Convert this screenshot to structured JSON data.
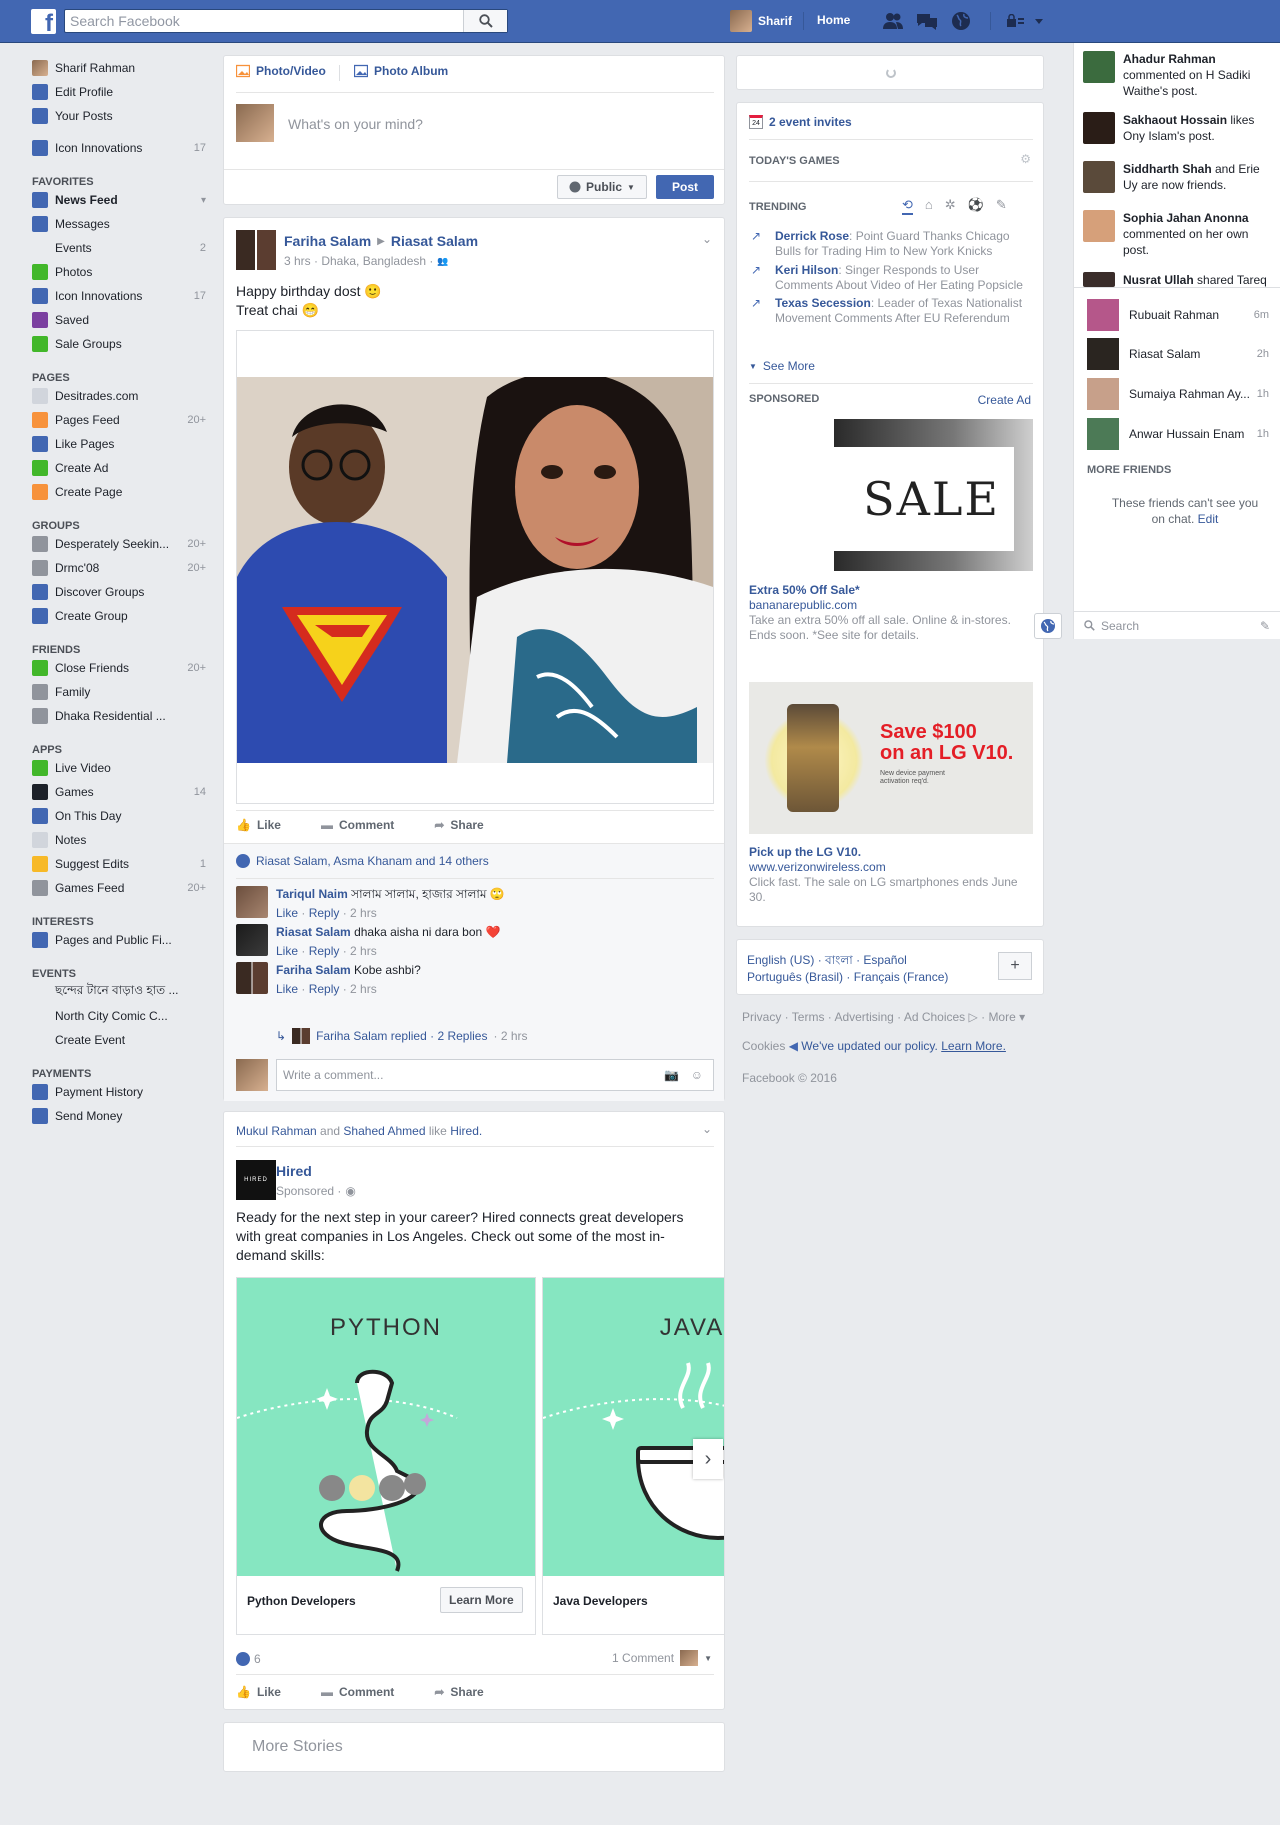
{
  "topbar": {
    "search_placeholder": "Search Facebook",
    "user_name": "Sharif",
    "home_label": "Home"
  },
  "leftnav": {
    "profile": [
      {
        "label": "Sharif Rahman",
        "icon": "avatar"
      },
      {
        "label": "Edit Profile",
        "icon": "pencil-icon"
      },
      {
        "label": "Your Posts",
        "icon": "person-icon"
      }
    ],
    "page_shortcut": {
      "label": "Icon Innovations",
      "count": "17"
    },
    "sections": [
      {
        "title": "FAVORITES",
        "items": [
          {
            "label": "News Feed",
            "count": "",
            "bold": true,
            "icon": "news-feed-icon",
            "color": "#4267b2"
          },
          {
            "label": "Messages",
            "count": "",
            "icon": "messages-icon",
            "color": "#4267b2"
          },
          {
            "label": "Events",
            "count": "2",
            "icon": "calendar-icon",
            "color": "#e9ebee"
          },
          {
            "label": "Photos",
            "count": "",
            "icon": "photos-icon",
            "color": "#42b72a"
          },
          {
            "label": "Icon Innovations",
            "count": "17",
            "icon": "page-icon",
            "color": "#4267b2"
          },
          {
            "label": "Saved",
            "count": "",
            "icon": "bookmark-icon",
            "color": "#7b3fa0"
          },
          {
            "label": "Sale Groups",
            "count": "",
            "icon": "tag-icon",
            "color": "#42b72a"
          }
        ]
      },
      {
        "title": "PAGES",
        "items": [
          {
            "label": "Desitrades.com",
            "count": "",
            "icon": "page-icon",
            "color": "#d1d5dc"
          },
          {
            "label": "Pages Feed",
            "count": "20+",
            "icon": "flag-icon",
            "color": "#f7923b"
          },
          {
            "label": "Like Pages",
            "count": "",
            "icon": "like-icon",
            "color": "#4267b2"
          },
          {
            "label": "Create Ad",
            "count": "",
            "icon": "plus-icon",
            "color": "#42b72a"
          },
          {
            "label": "Create Page",
            "count": "",
            "icon": "flag-plus-icon",
            "color": "#f7923b"
          }
        ]
      },
      {
        "title": "GROUPS",
        "items": [
          {
            "label": "Desperately Seekin...",
            "count": "20+",
            "icon": "group-icon",
            "color": "#90949c"
          },
          {
            "label": "Drmc'08",
            "count": "20+",
            "icon": "group-icon",
            "color": "#90949c"
          },
          {
            "label": "Discover Groups",
            "count": "",
            "icon": "discover-icon",
            "color": "#4267b2"
          },
          {
            "label": "Create Group",
            "count": "",
            "icon": "plus-icon",
            "color": "#4267b2"
          }
        ]
      },
      {
        "title": "FRIENDS",
        "items": [
          {
            "label": "Close Friends",
            "count": "20+",
            "icon": "star-icon",
            "color": "#42b72a"
          },
          {
            "label": "Family",
            "count": "",
            "icon": "family-icon",
            "color": "#90949c"
          },
          {
            "label": "Dhaka Residential ...",
            "count": "",
            "icon": "school-icon",
            "color": "#90949c"
          }
        ]
      },
      {
        "title": "APPS",
        "items": [
          {
            "label": "Live Video",
            "count": "",
            "icon": "live-icon",
            "color": "#42b72a"
          },
          {
            "label": "Games",
            "count": "14",
            "icon": "games-icon",
            "color": "#1d2129"
          },
          {
            "label": "On This Day",
            "count": "",
            "icon": "clock-icon",
            "color": "#4267b2"
          },
          {
            "label": "Notes",
            "count": "",
            "icon": "notes-icon",
            "color": "#d1d5dc"
          },
          {
            "label": "Suggest Edits",
            "count": "1",
            "icon": "edit-icon",
            "color": "#f7b928"
          },
          {
            "label": "Games Feed",
            "count": "20+",
            "icon": "games-feed-icon",
            "color": "#90949c"
          }
        ]
      },
      {
        "title": "INTERESTS",
        "items": [
          {
            "label": "Pages and Public Fi...",
            "count": "",
            "icon": "rss-icon",
            "color": "#4267b2"
          }
        ]
      },
      {
        "title": "EVENTS",
        "items": [
          {
            "label": "ছন্দের টানে বাড়াও হাত ...",
            "count": "",
            "icon": "calendar-icon",
            "color": "#e9ebee"
          },
          {
            "label": "North City Comic C...",
            "count": "",
            "icon": "calendar-icon",
            "color": "#e9ebee"
          },
          {
            "label": "Create Event",
            "count": "",
            "icon": "calendar-plus-icon",
            "color": "#e9ebee"
          }
        ]
      },
      {
        "title": "PAYMENTS",
        "items": [
          {
            "label": "Payment History",
            "count": "",
            "icon": "payment-icon",
            "color": "#4267b2"
          },
          {
            "label": "Send Money",
            "count": "",
            "icon": "money-icon",
            "color": "#4267b2"
          }
        ]
      }
    ]
  },
  "composer": {
    "photo_video": "Photo/Video",
    "photo_album": "Photo Album",
    "placeholder": "What's on your mind?",
    "privacy": "Public",
    "post_button": "Post"
  },
  "post1": {
    "author": "Fariha Salam",
    "target": "Riasat Salam",
    "meta": "3 hrs · Dhaka, Bangladesh ·",
    "text_line1": "Happy birthday dost 🙂",
    "text_line2": "Treat chai 😁",
    "like": "Like",
    "comment": "Comment",
    "share": "Share",
    "likes_summary": "Riasat Salam, Asma Khanam and 14 others",
    "comments": [
      {
        "author": "Tariqul Naim",
        "text": "সালাম সালাম, হাজার সালাম 🙄",
        "time": "2 hrs"
      },
      {
        "author": "Riasat Salam",
        "text": "dhaka aisha ni dara bon ❤️",
        "time": "2 hrs"
      },
      {
        "author": "Fariha Salam",
        "text": "Kobe ashbi?",
        "time": "2 hrs"
      }
    ],
    "reply_label": "Like",
    "reply_word": "Reply",
    "replied_text": "Fariha Salam replied · 2 Replies",
    "replied_time": "· 2 hrs",
    "write_comment": "Write a comment..."
  },
  "post2": {
    "liked_by": "Mukul Rahman and Shahed Ahmed like Hired.",
    "liker1": "Mukul Rahman",
    "liker2": "Shahed Ahmed",
    "and_word": "and",
    "like_word": "like",
    "page_name": "Hired.",
    "author": "Hired",
    "sponsored": "Sponsored ·",
    "logo_text": "HIRED",
    "text": "Ready for the next step in your career? Hired connects great developers with great companies in Los Angeles. Check out some of the most in-demand skills:",
    "cards": [
      {
        "heading": "PYTHON",
        "title": "Python Developers",
        "cta": "Learn More"
      },
      {
        "heading": "JAVA",
        "title": "Java Developers",
        "cta": ""
      }
    ],
    "reactions_count": "6",
    "comments_count": "1 Comment",
    "like": "Like",
    "comment": "Comment",
    "share": "Share"
  },
  "more_stories": "More Stories",
  "rightcol": {
    "event_invites": "2 event invites",
    "todays_games": "TODAY'S GAMES",
    "trending": "TRENDING",
    "trends": [
      {
        "name": "Derrick Rose",
        "text": ": Point Guard Thanks Chicago Bulls for Trading Him to New York Knicks"
      },
      {
        "name": "Keri Hilson",
        "text": ": Singer Responds to User Comments About Video of Her Eating Popsicle"
      },
      {
        "name": "Texas Secession",
        "text": ": Leader of Texas Nationalist Movement Comments After EU Referendum"
      }
    ],
    "see_more": "See More",
    "sponsored": "SPONSORED",
    "create_ad": "Create Ad",
    "ad1": {
      "image_text": "SALE",
      "title": "Extra 50% Off Sale*",
      "url": "bananarepublic.com",
      "desc": "Take an extra 50% off all sale. Online & in-stores. Ends soon. *See site for details."
    },
    "ad2": {
      "headline1": "Save $100",
      "headline2": "on an LG V10.",
      "fine1": "New device payment",
      "fine2": "activation req'd.",
      "title": "Pick up the LG V10.",
      "url": "www.verizonwireless.com",
      "desc": "Click fast. The sale on LG smartphones ends June 30."
    },
    "languages_line1": "English (US) · বাংলা · Español",
    "languages_line2": "Português (Brasil) · Français (France)",
    "footer_line1": "Privacy · Terms · Advertising · Ad Choices",
    "footer_more": "· More ▾",
    "footer_cookies": "Cookies",
    "footer_updated": "We've updated our policy.",
    "footer_learn": "Learn More.",
    "copyright": "Facebook © 2016"
  },
  "ticker": [
    {
      "name": "Ahadur Rahman",
      "text": " commented on H Sadiki Waithe's post."
    },
    {
      "name": "Sakhaout Hossain",
      "text": " likes Ony Islam's post."
    },
    {
      "name": "Siddharth Shah",
      "text": " and Erie Uy are now friends."
    },
    {
      "name": "Sophia Jahan Anonna",
      "text": " commented on her own post."
    },
    {
      "name": "Nusrat Ullah",
      "text": " shared Tareq"
    }
  ],
  "chat": {
    "friends": [
      {
        "name": "Rubuait Rahman",
        "time": "6m"
      },
      {
        "name": "Riasat Salam",
        "time": "2h"
      },
      {
        "name": "Sumaiya Rahman Ay...",
        "time": "1h"
      },
      {
        "name": "Anwar Hussain Enam",
        "time": "1h"
      }
    ],
    "more_friends": "MORE FRIENDS",
    "notice": "These friends can't see you on chat.",
    "notice_edit": "Edit",
    "search_placeholder": "Search"
  },
  "colors": {
    "brand": "#4267b2",
    "link": "#365899",
    "background": "#e9ebee"
  }
}
